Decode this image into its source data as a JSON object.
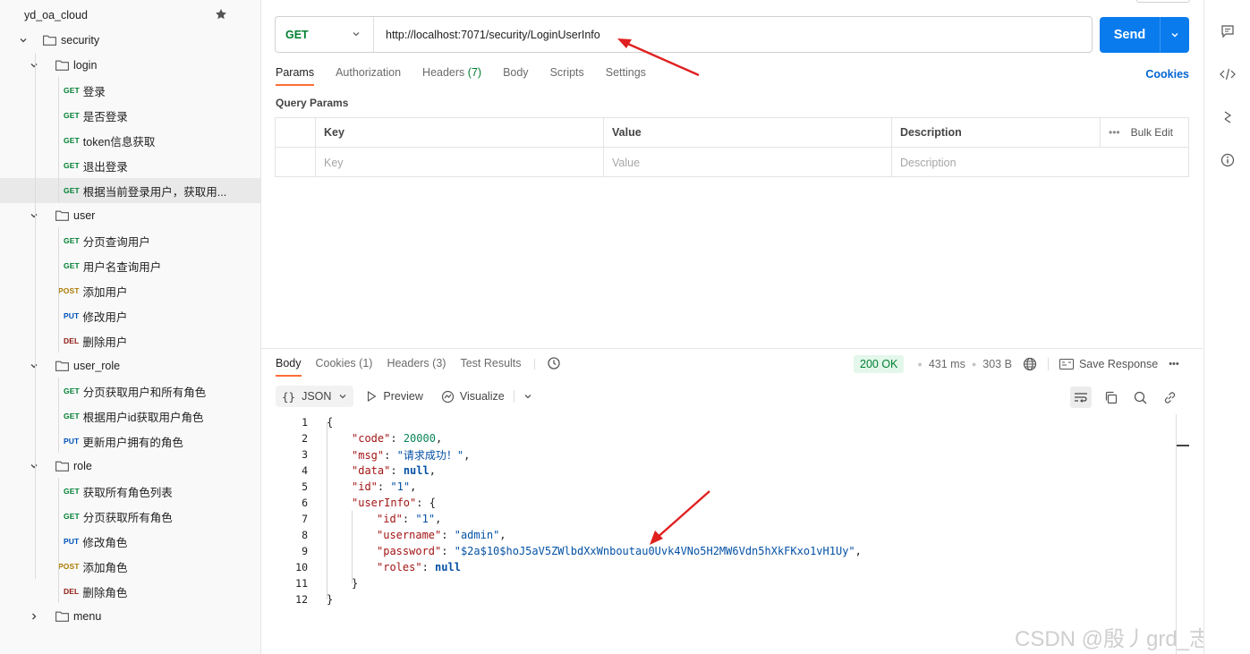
{
  "sidebar": {
    "collection": "yd_oa_cloud",
    "items": [
      {
        "type": "folder",
        "label": "security",
        "expanded": true
      },
      {
        "type": "folder",
        "label": "login",
        "expanded": true
      },
      {
        "type": "request",
        "method": "GET",
        "label": "登录"
      },
      {
        "type": "request",
        "method": "GET",
        "label": "是否登录"
      },
      {
        "type": "request",
        "method": "GET",
        "label": "token信息获取"
      },
      {
        "type": "request",
        "method": "GET",
        "label": "退出登录"
      },
      {
        "type": "request",
        "method": "GET",
        "label": "根据当前登录用户，获取用..."
      },
      {
        "type": "folder",
        "label": "user",
        "expanded": true
      },
      {
        "type": "request",
        "method": "GET",
        "label": "分页查询用户"
      },
      {
        "type": "request",
        "method": "GET",
        "label": "用户名查询用户"
      },
      {
        "type": "request",
        "method": "POST",
        "label": "添加用户"
      },
      {
        "type": "request",
        "method": "PUT",
        "label": "修改用户"
      },
      {
        "type": "request",
        "method": "DEL",
        "label": "删除用户"
      },
      {
        "type": "folder",
        "label": "user_role",
        "expanded": true
      },
      {
        "type": "request",
        "method": "GET",
        "label": "分页获取用户和所有角色"
      },
      {
        "type": "request",
        "method": "GET",
        "label": "根据用户id获取用户角色"
      },
      {
        "type": "request",
        "method": "PUT",
        "label": "更新用户拥有的角色"
      },
      {
        "type": "folder",
        "label": "role",
        "expanded": true
      },
      {
        "type": "request",
        "method": "GET",
        "label": "获取所有角色列表"
      },
      {
        "type": "request",
        "method": "GET",
        "label": "分页获取所有角色"
      },
      {
        "type": "request",
        "method": "PUT",
        "label": "修改角色"
      },
      {
        "type": "request",
        "method": "POST",
        "label": "添加角色"
      },
      {
        "type": "request",
        "method": "DEL",
        "label": "删除角色"
      },
      {
        "type": "folder",
        "label": "menu",
        "expanded": false
      }
    ]
  },
  "request": {
    "method": "GET",
    "url": "http://localhost:7071/security/LoginUserInfo",
    "send_label": "Send",
    "tabs": [
      {
        "label": "Params",
        "count": ""
      },
      {
        "label": "Authorization",
        "count": ""
      },
      {
        "label": "Headers",
        "count": "(7)"
      },
      {
        "label": "Body",
        "count": ""
      },
      {
        "label": "Scripts",
        "count": ""
      },
      {
        "label": "Settings",
        "count": ""
      }
    ],
    "cookies_link": "Cookies",
    "query_params_title": "Query Params",
    "params_headers": {
      "key": "Key",
      "value": "Value",
      "description": "Description",
      "bulk_edit": "Bulk Edit"
    },
    "params_placeholders": {
      "key": "Key",
      "value": "Value",
      "description": "Description"
    }
  },
  "response": {
    "tabs": [
      {
        "label": "Body",
        "count": ""
      },
      {
        "label": "Cookies",
        "count": "(1)"
      },
      {
        "label": "Headers",
        "count": "(3)"
      },
      {
        "label": "Test Results",
        "count": ""
      }
    ],
    "status": "200 OK",
    "time": "431 ms",
    "size": "303 B",
    "save_response": "Save Response",
    "format": "JSON",
    "preview": "Preview",
    "visualize": "Visualize",
    "line_numbers": [
      "1",
      "2",
      "3",
      "4",
      "5",
      "6",
      "7",
      "8",
      "9",
      "10",
      "11",
      "12"
    ],
    "body": {
      "code": 20000,
      "msg": "请求成功！",
      "id": "1",
      "userInfo": {
        "id": "1",
        "username": "admin",
        "password": "$2a$10$hoJ5aV5ZWlbdXxWnboutau0Uvk4VNo5H2MW6Vdn5hXkFKxo1vH1Uy"
      }
    }
  },
  "watermark": "CSDN @殷丿grd_志鹏",
  "colors": {
    "accent": "#ff6c37",
    "send": "#097bed",
    "get": "#007f31",
    "post": "#ad7a03",
    "put": "#0053b8",
    "del": "#8e1a10",
    "annotation_arrow": "#e02020"
  }
}
